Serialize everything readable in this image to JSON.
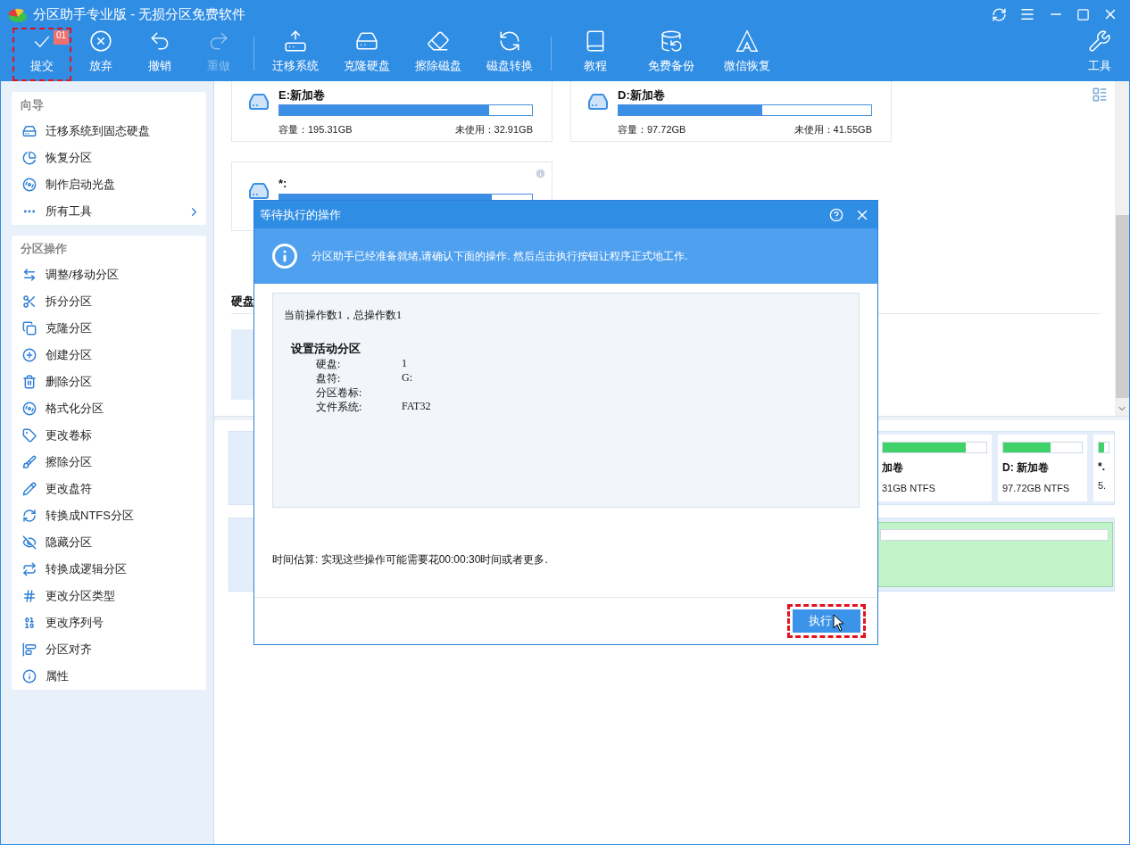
{
  "window": {
    "title": "分区助手专业版 - 无损分区免费软件"
  },
  "toolbar": {
    "groups": [
      [
        {
          "label": "提交",
          "badge": "01",
          "disabled": false,
          "highlighted": true
        },
        {
          "label": "放弃",
          "disabled": false,
          "highlighted": false
        },
        {
          "label": "撤销",
          "disabled": false,
          "highlighted": false
        },
        {
          "label": "重做",
          "disabled": true,
          "highlighted": false
        }
      ],
      [
        {
          "label": "迁移系统",
          "disabled": false,
          "highlighted": false
        },
        {
          "label": "克隆硬盘",
          "disabled": false,
          "highlighted": false
        },
        {
          "label": "擦除磁盘",
          "disabled": false,
          "highlighted": false
        },
        {
          "label": "磁盘转换",
          "disabled": false,
          "highlighted": false
        }
      ],
      [
        {
          "label": "教程",
          "disabled": false,
          "highlighted": false
        },
        {
          "label": "免费备份",
          "disabled": false,
          "highlighted": false
        },
        {
          "label": "微信恢复",
          "disabled": false,
          "highlighted": false
        }
      ]
    ],
    "tools": {
      "label": "工具",
      "disabled": false,
      "highlighted": false
    }
  },
  "sidebar": {
    "sections": [
      {
        "title": "向导",
        "items": [
          {
            "label": "迁移系统到固态硬盘",
            "submenu": false
          },
          {
            "label": "恢复分区",
            "submenu": false
          },
          {
            "label": "制作启动光盘",
            "submenu": false
          },
          {
            "label": "所有工具",
            "submenu": true
          }
        ]
      },
      {
        "title": "分区操作",
        "items": [
          {
            "label": "调整/移动分区",
            "submenu": false
          },
          {
            "label": "拆分分区",
            "submenu": false
          },
          {
            "label": "克隆分区",
            "submenu": false
          },
          {
            "label": "创建分区",
            "submenu": false
          },
          {
            "label": "删除分区",
            "submenu": false
          },
          {
            "label": "格式化分区",
            "submenu": false
          },
          {
            "label": "更改卷标",
            "submenu": false
          },
          {
            "label": "擦除分区",
            "submenu": false
          },
          {
            "label": "更改盘符",
            "submenu": false
          },
          {
            "label": "转换成NTFS分区",
            "submenu": false
          },
          {
            "label": "隐藏分区",
            "submenu": false
          },
          {
            "label": "转换成逻辑分区",
            "submenu": false
          },
          {
            "label": "更改分区类型",
            "submenu": false
          },
          {
            "label": "更改序列号",
            "submenu": false
          },
          {
            "label": "分区对齐",
            "submenu": false
          },
          {
            "label": "属性",
            "submenu": false
          }
        ]
      }
    ]
  },
  "partitions": [
    {
      "name": "E:新加卷",
      "level": 0.83,
      "capacity": "容量：195.31GB",
      "free": "未使用：32.91GB",
      "info": false
    },
    {
      "name": "D:新加卷",
      "level": 0.57,
      "capacity": "容量：97.72GB",
      "free": "未使用：41.55GB",
      "info": false
    },
    {
      "name": "*:",
      "level": 0.84,
      "info": true
    }
  ],
  "disk_section": {
    "label": "硬盘"
  },
  "disk_map": {
    "rows": [
      {
        "partitions": [
          {
            "name": "加卷",
            "detail": "31GB NTFS",
            "level": 0.8,
            "selected": false
          },
          {
            "name": "D: 新加卷",
            "detail": "97.72GB NTFS",
            "level": 0.6,
            "selected": false
          },
          {
            "name": "*.",
            "detail": "5.",
            "level": 0.5,
            "selected": false
          }
        ]
      },
      {
        "partitions": [
          {
            "selected": true
          }
        ]
      }
    ]
  },
  "dialog": {
    "title": "等待执行的操作",
    "notice": "分区助手已经准备就绪,请确认下面的操作. 然后点击执行按钮让程序正式地工作.",
    "summary": "当前操作数1，总操作数1",
    "operation": {
      "title": "设置活动分区",
      "fields": [
        {
          "label": "硬盘:",
          "value": "1"
        },
        {
          "label": "盘符:",
          "value": "G:"
        },
        {
          "label": "分区卷标:"
        },
        {
          "label": "文件系统:",
          "value": "FAT32"
        }
      ]
    },
    "estimate": "时间估算: 实现这些操作可能需要花00:00:30时间或者更多.",
    "button": {
      "label": "执行",
      "highlighted": true
    }
  }
}
